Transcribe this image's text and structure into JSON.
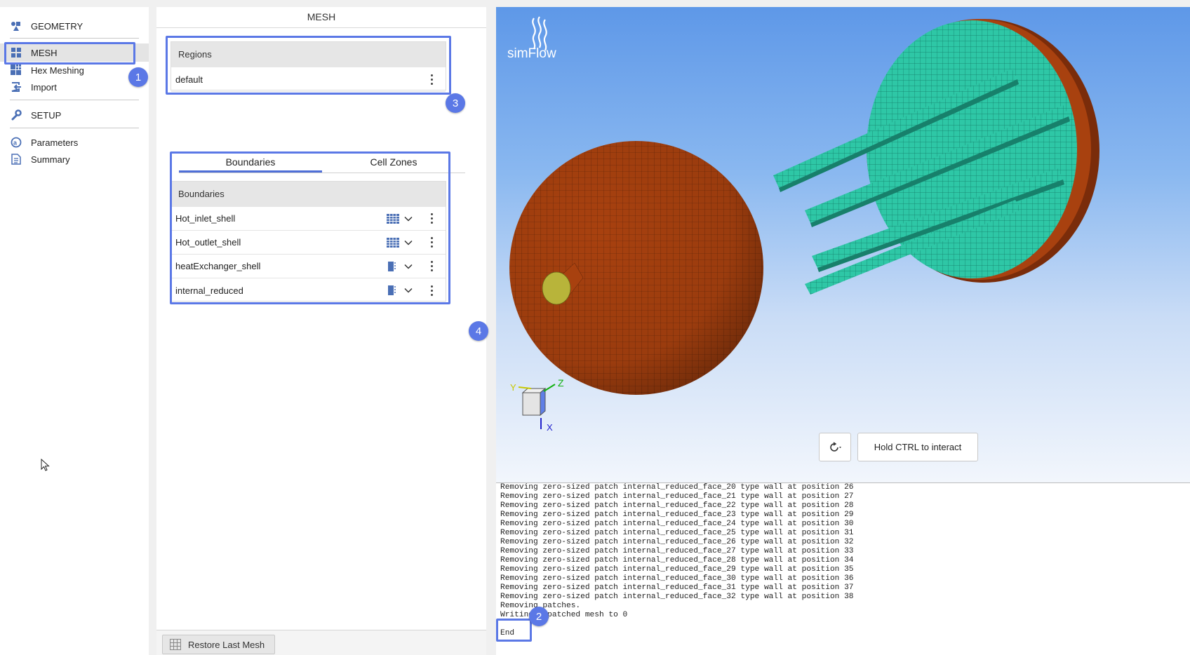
{
  "sidebar": {
    "items": [
      {
        "label": "GEOMETRY",
        "icon": "geometry-icon"
      },
      {
        "label": "MESH",
        "icon": "mesh-grid-icon"
      },
      {
        "label": "Hex Meshing",
        "icon": "hex-mesh-icon"
      },
      {
        "label": "Import",
        "icon": "import-icon"
      },
      {
        "label": "SETUP",
        "icon": "wrench-icon"
      },
      {
        "label": "Parameters",
        "icon": "parameters-icon"
      },
      {
        "label": "Summary",
        "icon": "summary-icon"
      }
    ],
    "active": "MESH"
  },
  "mesh_panel": {
    "title": "MESH",
    "regions": {
      "header": "Regions",
      "rows": [
        "default"
      ]
    },
    "tabs": [
      "Boundaries",
      "Cell Zones"
    ],
    "active_tab": "Boundaries",
    "boundaries": {
      "header": "Boundaries",
      "rows": [
        {
          "name": "Hot_inlet_shell",
          "icon": "mesh-surface-icon"
        },
        {
          "name": "Hot_outlet_shell",
          "icon": "mesh-surface-icon"
        },
        {
          "name": "heatExchanger_shell",
          "icon": "half-surface-icon"
        },
        {
          "name": "internal_reduced",
          "icon": "half-surface-icon"
        }
      ]
    },
    "restore_button": "Restore Last Mesh"
  },
  "annotations": {
    "badge1": "1",
    "badge2": "2",
    "badge3": "3",
    "badge4": "4"
  },
  "viewport": {
    "logo_text": "simFlow",
    "hold_ctrl": "Hold CTRL to interact",
    "axes": {
      "x": "X",
      "y": "Y",
      "z": "Z"
    },
    "colors": {
      "sphere": "#a8410f",
      "mesh_green": "#2fc9a8",
      "background_top": "#5e98e8"
    }
  },
  "console": {
    "lines": [
      "Removing zero-sized patch internal_reduced_face_20 type wall at position 26",
      "Removing zero-sized patch internal_reduced_face_21 type wall at position 27",
      "Removing zero-sized patch internal_reduced_face_22 type wall at position 28",
      "Removing zero-sized patch internal_reduced_face_23 type wall at position 29",
      "Removing zero-sized patch internal_reduced_face_24 type wall at position 30",
      "Removing zero-sized patch internal_reduced_face_25 type wall at position 31",
      "Removing zero-sized patch internal_reduced_face_26 type wall at position 32",
      "Removing zero-sized patch internal_reduced_face_27 type wall at position 33",
      "Removing zero-sized patch internal_reduced_face_28 type wall at position 34",
      "Removing zero-sized patch internal_reduced_face_29 type wall at position 35",
      "Removing zero-sized patch internal_reduced_face_30 type wall at position 36",
      "Removing zero-sized patch internal_reduced_face_31 type wall at position 37",
      "Removing zero-sized patch internal_reduced_face_32 type wall at position 38",
      "Removing patches.",
      "Writing repatched mesh to 0"
    ],
    "end": "End"
  }
}
